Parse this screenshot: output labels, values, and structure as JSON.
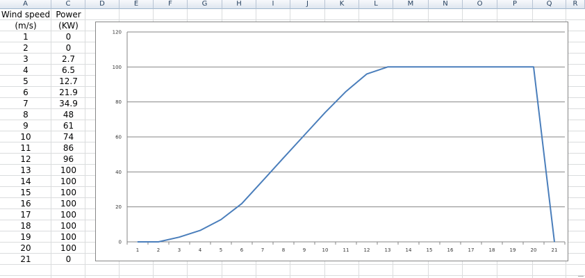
{
  "sheet": {
    "columns": [
      "A",
      "C",
      "D",
      "E",
      "F",
      "G",
      "H",
      "I",
      "J",
      "K",
      "L",
      "M",
      "N",
      "O",
      "P",
      "Q",
      "R"
    ],
    "header_row": [
      "Wind speed",
      "Power"
    ],
    "unit_row": [
      "(m/s)",
      "(KW)"
    ],
    "rows": [
      [
        "1",
        "0"
      ],
      [
        "2",
        "0"
      ],
      [
        "3",
        "2.7"
      ],
      [
        "4",
        "6.5"
      ],
      [
        "5",
        "12.7"
      ],
      [
        "6",
        "21.9"
      ],
      [
        "7",
        "34.9"
      ],
      [
        "8",
        "48"
      ],
      [
        "9",
        "61"
      ],
      [
        "10",
        "74"
      ],
      [
        "11",
        "86"
      ],
      [
        "12",
        "96"
      ],
      [
        "13",
        "100"
      ],
      [
        "14",
        "100"
      ],
      [
        "15",
        "100"
      ],
      [
        "16",
        "100"
      ],
      [
        "17",
        "100"
      ],
      [
        "18",
        "100"
      ],
      [
        "19",
        "100"
      ],
      [
        "20",
        "100"
      ],
      [
        "21",
        "0"
      ]
    ]
  },
  "chart_data": {
    "type": "line",
    "categories": [
      "1",
      "2",
      "3",
      "4",
      "5",
      "6",
      "7",
      "8",
      "9",
      "10",
      "11",
      "12",
      "13",
      "14",
      "15",
      "16",
      "17",
      "18",
      "19",
      "20",
      "21"
    ],
    "series": [
      {
        "values": [
          0,
          0,
          2.7,
          6.5,
          12.7,
          21.9,
          34.9,
          48,
          61,
          74,
          86,
          96,
          100,
          100,
          100,
          100,
          100,
          100,
          100,
          100,
          0
        ]
      }
    ],
    "y_ticks": [
      "0",
      "20",
      "40",
      "60",
      "80",
      "100",
      "120"
    ],
    "ylim": [
      0,
      120
    ],
    "grid": "horizontal",
    "line_color": "#4a7ebb",
    "grid_color": "#868686"
  }
}
